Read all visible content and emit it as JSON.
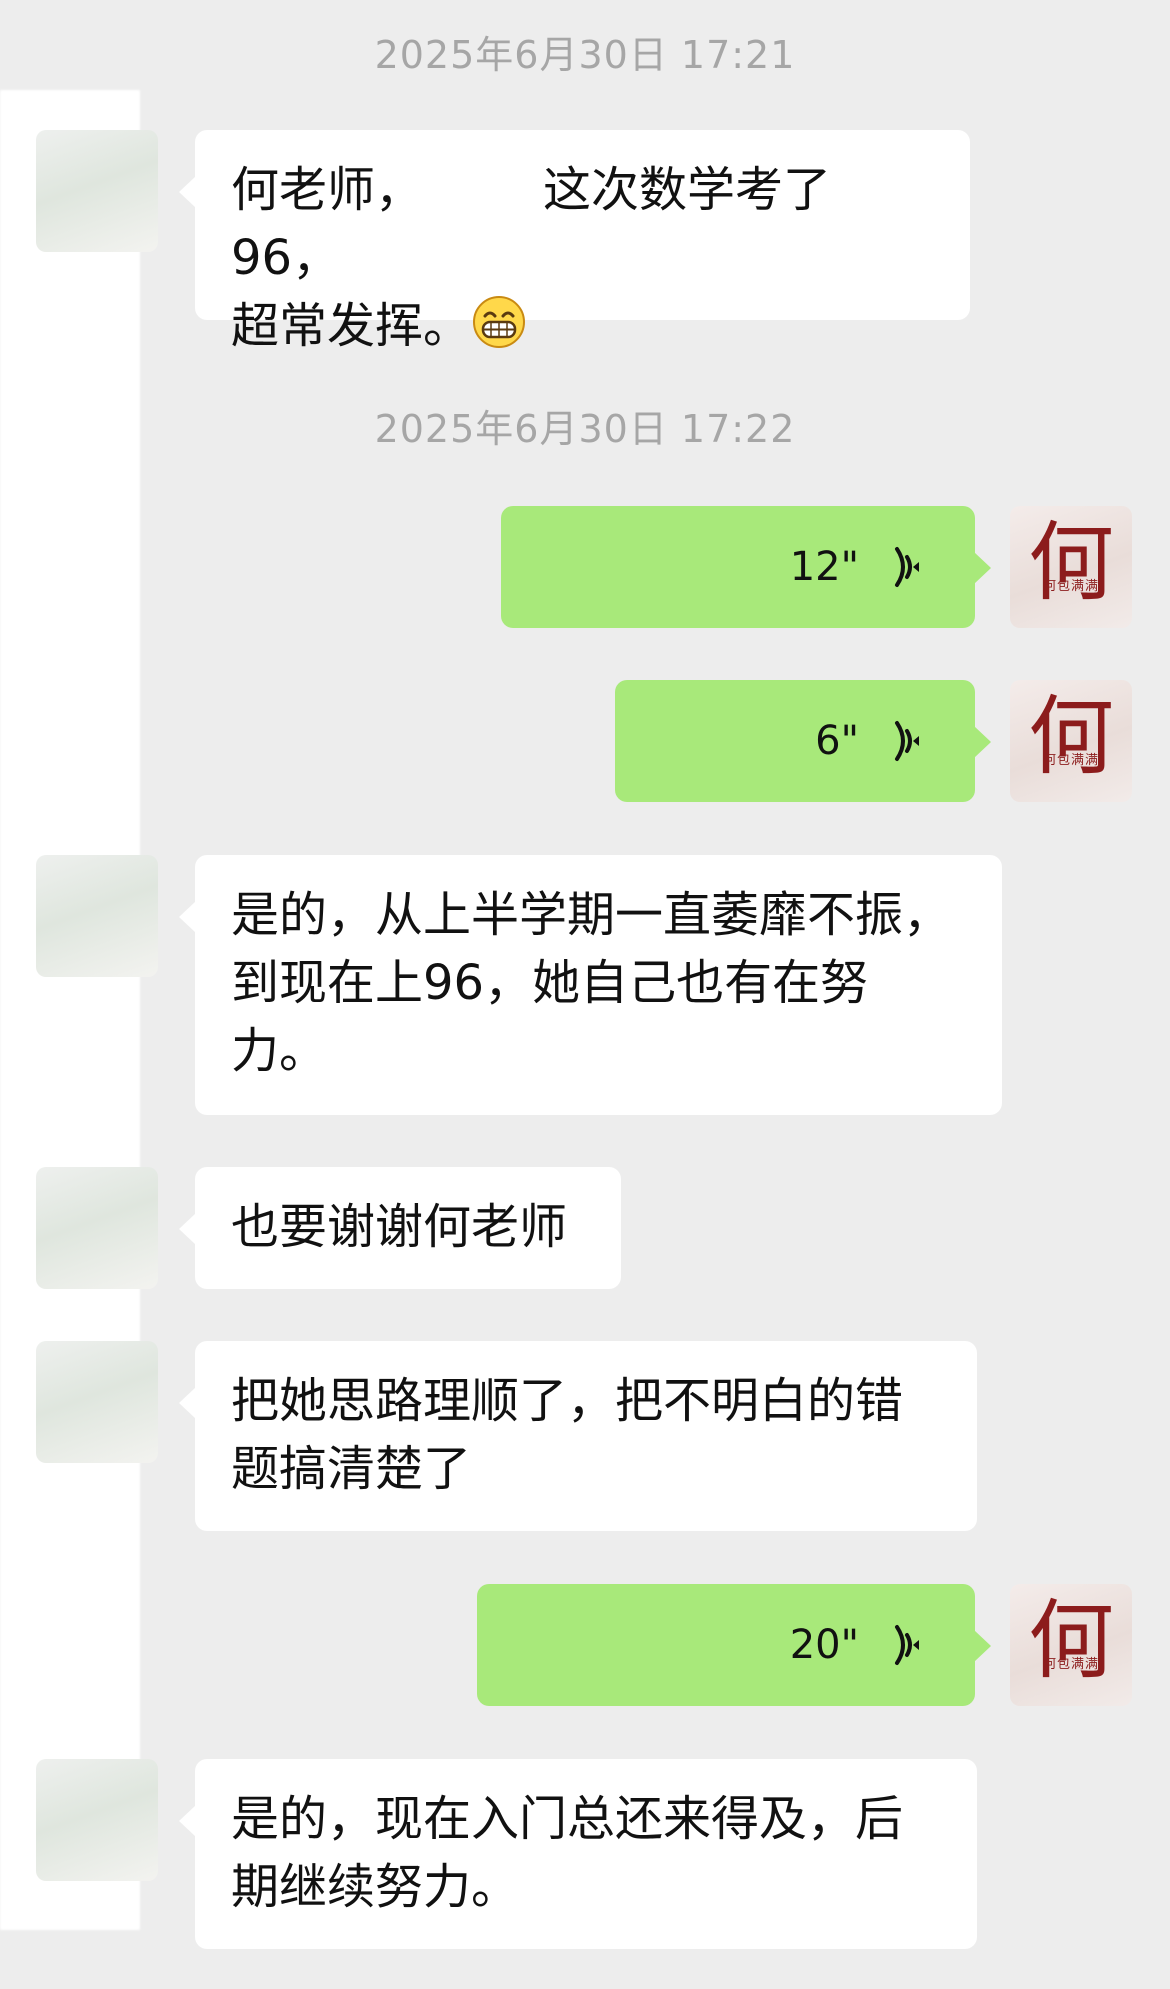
{
  "messages": [
    {
      "type": "timestamp",
      "text": "2025年6月30日 17:21"
    },
    {
      "type": "received_text",
      "lines": [
        "何老师，",
        "这次数学考了96，",
        "超常发挥。"
      ],
      "emoji": "grinning-face"
    },
    {
      "type": "timestamp",
      "text": "2025年6月30日 17:22"
    },
    {
      "type": "sent_voice",
      "duration": "12\""
    },
    {
      "type": "sent_voice",
      "duration": "6\""
    },
    {
      "type": "received_text",
      "lines": [
        "是的，从上半学期一直萎靡不振，",
        "到现在上96，她自己也有在努",
        "力。"
      ]
    },
    {
      "type": "received_text",
      "lines": [
        "也要谢谢何老师"
      ]
    },
    {
      "type": "received_text",
      "lines": [
        "把她思路理顺了，把不明白的错",
        "题搞清楚了"
      ]
    },
    {
      "type": "sent_voice",
      "duration": "20\""
    },
    {
      "type": "received_text",
      "lines": [
        "是的，现在入门总还来得及，后",
        "期继续努力。"
      ]
    }
  ],
  "self_avatar": {
    "char": "何",
    "sub": "何包满满"
  },
  "colors": {
    "background": "#ededed",
    "sent_bubble": "#a8e97a",
    "received_bubble": "#ffffff",
    "timestamp_text": "#a6a6a6",
    "avatar_accent": "#8c1c1c"
  },
  "icons": {
    "voice": "voice-wave-icon",
    "emoji": "grinning-emoji-icon"
  }
}
